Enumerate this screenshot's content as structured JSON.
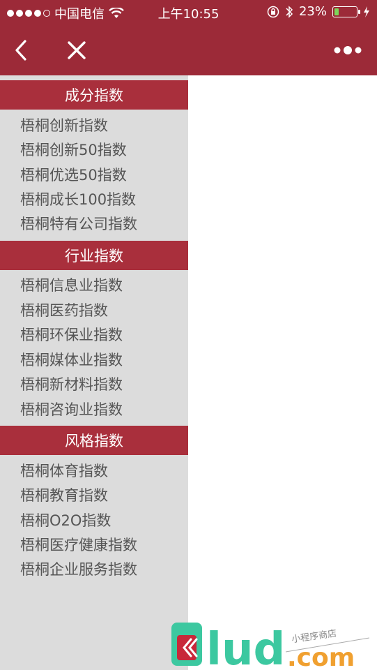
{
  "status_bar": {
    "carrier": "中国电信",
    "time": "上午10:55",
    "battery_percent_text": "23%",
    "battery_level": 0.23,
    "icons": [
      "signal-dots-icon",
      "wifi-icon",
      "orientation-lock-icon",
      "bluetooth-icon",
      "battery-icon",
      "charging-bolt-icon"
    ]
  },
  "navbar": {
    "icons": [
      "chevron-left-icon",
      "close-icon",
      "more-dots-icon"
    ],
    "color": "#9c2a38"
  },
  "sections": [
    {
      "title": "成分指数",
      "items": [
        "梧桐创新指数",
        "梧桐创新50指数",
        "梧桐优选50指数",
        "梧桐成长100指数",
        "梧桐特有公司指数"
      ]
    },
    {
      "title": "行业指数",
      "items": [
        "梧桐信息业指数",
        "梧桐医药指数",
        "梧桐环保业指数",
        "梧桐媒体业指数",
        "梧桐新材料指数",
        "梧桐咨询业指数"
      ]
    },
    {
      "title": "风格指数",
      "items": [
        "梧桐体育指数",
        "梧桐教育指数",
        "梧桐O2O指数",
        "梧桐医疗健康指数",
        "梧桐企业服务指数"
      ]
    }
  ],
  "watermark": {
    "brand": "lud",
    "domain": ".com",
    "tagline": "小程序商店"
  },
  "colors": {
    "header_bg": "#9c2a38",
    "section_header_bg": "#a92f3c",
    "sidebar_bg": "#dcdcdc",
    "item_text": "#555555",
    "watermark_green": "#3cc8a0",
    "watermark_orange": "#f0a030"
  }
}
